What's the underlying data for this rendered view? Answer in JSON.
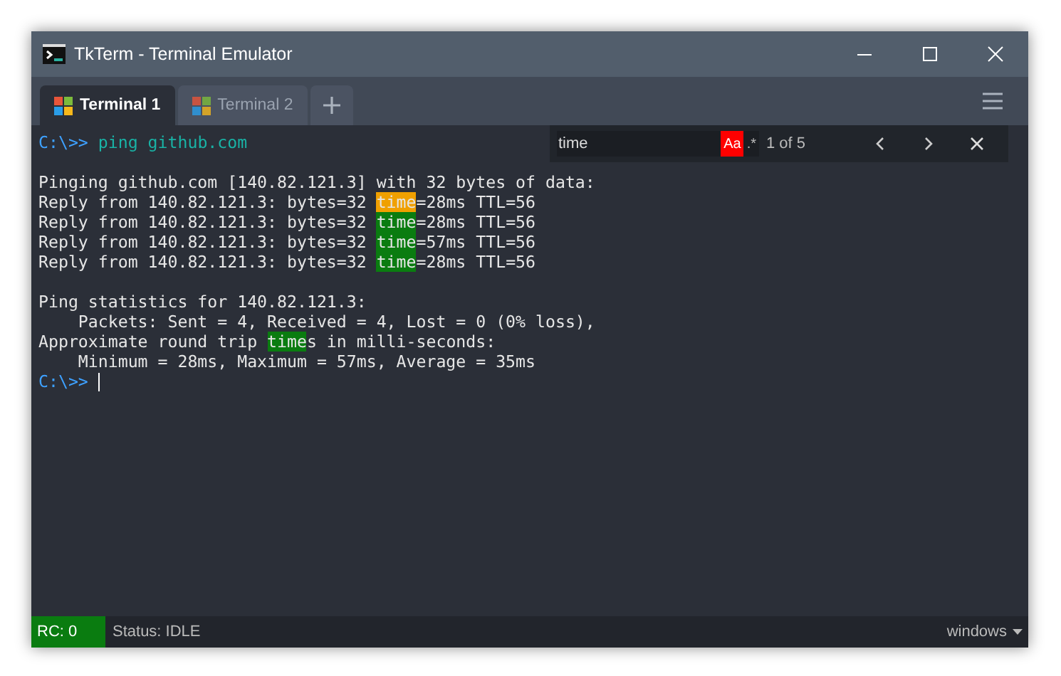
{
  "window": {
    "title": "TkTerm - Terminal Emulator"
  },
  "tabs": [
    {
      "label": "Terminal 1",
      "selected": true
    },
    {
      "label": "Terminal 2",
      "selected": false
    }
  ],
  "search": {
    "value": "time",
    "options": [
      {
        "label": "Aa",
        "on": true
      },
      {
        "label": ".*",
        "on": false
      }
    ],
    "count": "1 of 5"
  },
  "terminal": {
    "lines": [
      {
        "kind": "text",
        "segments": [
          {
            "text": "C:\\>> ",
            "kind": "prompt"
          },
          {
            "text": "ping github.com",
            "kind": "command"
          }
        ]
      },
      {
        "kind": "blank"
      },
      {
        "kind": "text",
        "segments": [
          {
            "text": "Pinging github.com [140.82.121.3] with 32 bytes of data:",
            "kind": "output"
          }
        ]
      },
      {
        "kind": "text",
        "segments": [
          {
            "text": "Reply from 140.82.121.3: bytes=32 ",
            "kind": "output"
          },
          {
            "text": "time",
            "kind": "current"
          },
          {
            "text": "=28ms TTL=56",
            "kind": "output"
          }
        ]
      },
      {
        "kind": "text",
        "segments": [
          {
            "text": "Reply from 140.82.121.3: bytes=32 ",
            "kind": "output"
          },
          {
            "text": "time",
            "kind": "match"
          },
          {
            "text": "=28ms TTL=56",
            "kind": "output"
          }
        ]
      },
      {
        "kind": "text",
        "segments": [
          {
            "text": "Reply from 140.82.121.3: bytes=32 ",
            "kind": "output"
          },
          {
            "text": "time",
            "kind": "match"
          },
          {
            "text": "=57ms TTL=56",
            "kind": "output"
          }
        ]
      },
      {
        "kind": "text",
        "segments": [
          {
            "text": "Reply from 140.82.121.3: bytes=32 ",
            "kind": "output"
          },
          {
            "text": "time",
            "kind": "match"
          },
          {
            "text": "=28ms TTL=56",
            "kind": "output"
          }
        ]
      },
      {
        "kind": "blank"
      },
      {
        "kind": "text",
        "segments": [
          {
            "text": "Ping statistics for 140.82.121.3:",
            "kind": "output"
          }
        ]
      },
      {
        "kind": "text",
        "segments": [
          {
            "text": "    Packets: Sent = 4, Received = 4, Lost = 0 (0% loss),",
            "kind": "output"
          }
        ]
      },
      {
        "kind": "text",
        "segments": [
          {
            "text": "Approximate round trip ",
            "kind": "output"
          },
          {
            "text": "time",
            "kind": "match"
          },
          {
            "text": "s in milli-seconds:",
            "kind": "output"
          }
        ]
      },
      {
        "kind": "text",
        "segments": [
          {
            "text": "    Minimum = 28ms, Maximum = 57ms, Average = 35ms",
            "kind": "output"
          }
        ]
      },
      {
        "kind": "text",
        "cursor": true,
        "segments": [
          {
            "text": "C:\\>> ",
            "kind": "prompt"
          }
        ]
      }
    ]
  },
  "status_bar": {
    "return_code": "RC: 0",
    "status": "Status: IDLE",
    "shell": "windows"
  }
}
